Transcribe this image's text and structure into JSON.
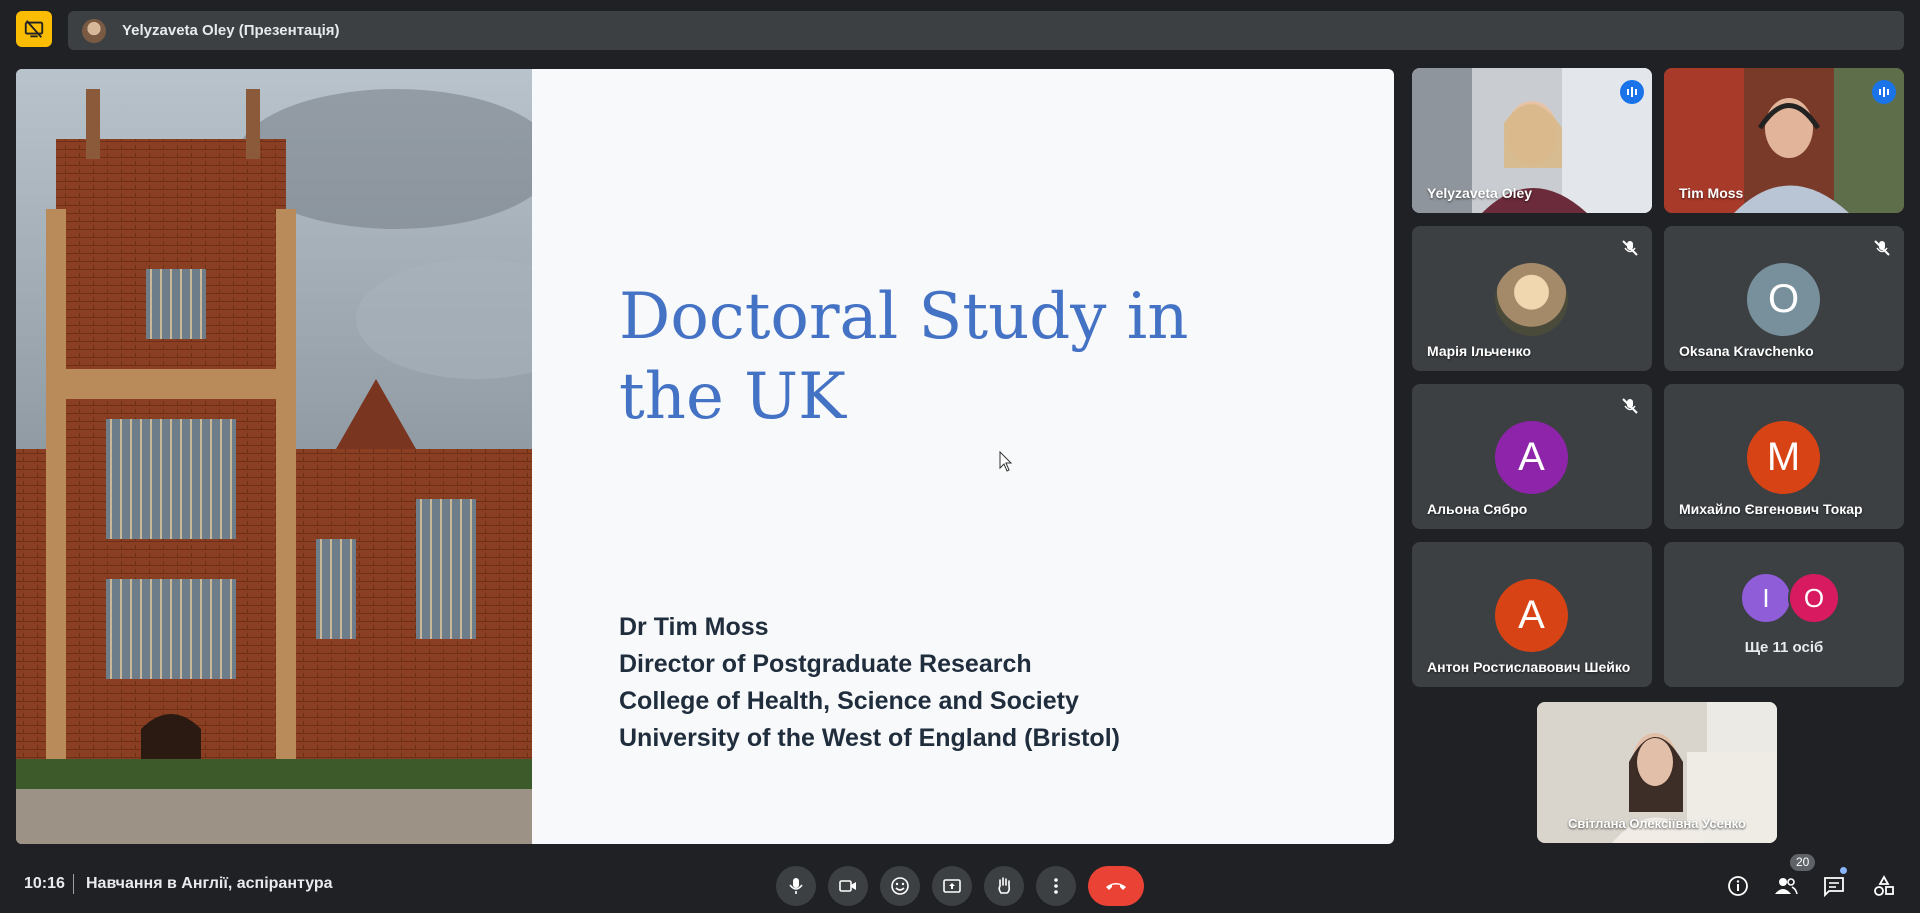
{
  "topbar": {
    "presenter_label": "Yelyzaveta Oley (Презентація)"
  },
  "slide": {
    "title": "Doctoral Study in the UK",
    "author_lines": [
      "Dr Tim Moss",
      "Director of Postgraduate Research",
      "College of Health, Science and Society",
      "University of the West of England (Bristol)"
    ]
  },
  "participants": [
    {
      "name": "Yelyzaveta Oley",
      "state": "speaking-video"
    },
    {
      "name": "Tim Moss",
      "state": "speaking-video"
    },
    {
      "name": "Марія Ільченко",
      "state": "muted-photo"
    },
    {
      "name": "Oksana Kravchenko",
      "initial": "O",
      "color": "#78909c",
      "state": "muted"
    },
    {
      "name": "Альона Сябро",
      "initial": "A",
      "color": "#8e24aa",
      "state": "muted"
    },
    {
      "name": "Михайло Євгенович Токар",
      "initial": "M",
      "color": "#d84315",
      "state": "unmuted"
    },
    {
      "name": "Антон Ростиславович Шейко",
      "initial": "A",
      "color": "#d84315",
      "state": "unmuted"
    }
  ],
  "more_tile": {
    "avatars": [
      {
        "initial": "I",
        "color": "#8e5dd7"
      },
      {
        "initial": "O",
        "color": "#d81b60"
      }
    ],
    "label": "Ще 11 осіб"
  },
  "self_view": {
    "name": "Світлана Олексіївна Усенко"
  },
  "bottom": {
    "time": "10:16",
    "meeting_title": "Навчання в Англії, аспірантура",
    "participant_count": "20"
  },
  "icons": {
    "present": "present-off-icon",
    "controls": [
      "mic-icon",
      "camera-icon",
      "emoji-icon",
      "present-screen-icon",
      "raise-hand-icon",
      "more-options-icon",
      "end-call-icon"
    ],
    "right": [
      "info-icon",
      "people-icon",
      "chat-icon",
      "activities-icon"
    ]
  },
  "colors": {
    "accent": "#8ab4f8",
    "end_call": "#ea4335",
    "present_badge": "#fbbc04",
    "slide_title": "#4472c4"
  }
}
